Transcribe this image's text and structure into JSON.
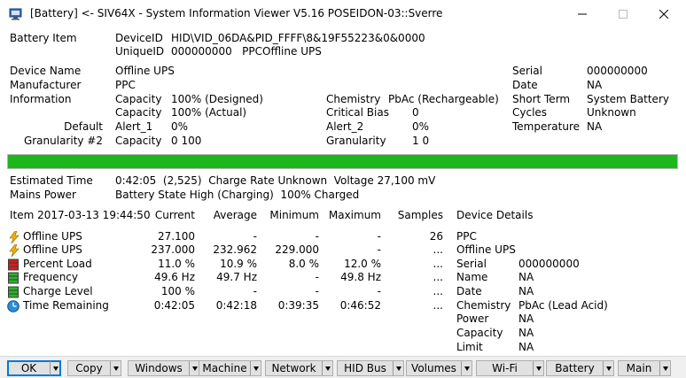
{
  "window": {
    "title": "[Battery] <- SIV64X - System Information Viewer V5.16 POSEIDON-03::Sverre"
  },
  "header": {
    "battery_item_label": "Battery Item",
    "device_id_key": "DeviceID",
    "device_id_value": "HID\\VID_06DA&PID_FFFF\\8&19F55223&0&0000",
    "unique_id_key": "UniqueID",
    "unique_id_value": "000000000   PPCOffline UPS"
  },
  "info": {
    "device_name_label": "Device Name",
    "device_name_value": "Offline UPS",
    "manufacturer_label": "Manufacturer",
    "manufacturer_value": "PPC",
    "information_label": "Information",
    "default_label": "Default",
    "granularity_label": "Granularity #2",
    "capacity1_key": "Capacity",
    "capacity1_value": "100% (Designed)",
    "capacity2_key": "Capacity",
    "capacity2_value": "100% (Actual)",
    "alert1_key": "Alert_1",
    "alert1_value": "0%",
    "capacity3_key": "Capacity",
    "capacity3_value": "0 100",
    "chemistry_key": "Chemistry",
    "chemistry_value": "PbAc (Rechargeable)",
    "critical_bias_key": "Critical Bias",
    "critical_bias_value": "0",
    "alert2_key": "Alert_2",
    "alert2_value": "0%",
    "granularity_key": "Granularity",
    "granularity_value": "1 0",
    "serial_key": "Serial",
    "serial_value": "000000000",
    "date_key": "Date",
    "date_value": "NA",
    "short_term_key": "Short Term",
    "short_term_value": "System Battery",
    "cycles_key": "Cycles",
    "cycles_value": "Unknown",
    "temperature_key": "Temperature",
    "temperature_value": "NA"
  },
  "charge": {
    "level_percent": 100,
    "color": "#1db61d"
  },
  "status": {
    "estimated_time_label": "Estimated Time",
    "estimated_time_value": "0:42:05  (2,525)  Charge Rate Unknown  Voltage 27,100 mV",
    "mains_power_label": "Mains Power",
    "mains_power_value": "Battery State High (Charging)  100% Charged"
  },
  "table": {
    "item_header": "Item 2017-03-13 19:44:50",
    "headers": [
      "Current",
      "Average",
      "Minimum",
      "Maximum",
      "Samples",
      "Device Details"
    ],
    "rows": [
      {
        "icon": "lightning-icon",
        "label": "Offline UPS",
        "current": "27.100",
        "average": "-",
        "minimum": "-",
        "maximum": "-",
        "samples": "26"
      },
      {
        "icon": "lightning-icon",
        "label": "Offline UPS",
        "current": "237.000",
        "average": "232.962",
        "minimum": "229.000",
        "maximum": "-",
        "samples": "..."
      },
      {
        "icon": "battery-red-icon",
        "label": "Percent Load",
        "current": "11.0 %",
        "average": "10.9 %",
        "minimum": "8.0 %",
        "maximum": "12.0 %",
        "samples": "..."
      },
      {
        "icon": "battery-green-icon",
        "label": "Frequency",
        "current": "49.6 Hz",
        "average": "49.7 Hz",
        "minimum": "-",
        "maximum": "49.8 Hz",
        "samples": "..."
      },
      {
        "icon": "battery-green-icon",
        "label": "Charge Level",
        "current": "100 %",
        "average": "-",
        "minimum": "-",
        "maximum": "-",
        "samples": "..."
      },
      {
        "icon": "clock-icon",
        "label": "Time Remaining",
        "current": "0:42:05",
        "average": "0:42:18",
        "minimum": "0:39:35",
        "maximum": "0:46:52",
        "samples": "..."
      }
    ],
    "details": [
      {
        "key": "PPC",
        "value": ""
      },
      {
        "key": "Offline UPS",
        "value": ""
      },
      {
        "key": "Serial",
        "value": "000000000"
      },
      {
        "key": "Name",
        "value": "NA"
      },
      {
        "key": "Date",
        "value": "NA"
      },
      {
        "key": "Chemistry",
        "value": "PbAc (Lead Acid)"
      },
      {
        "key": "Power",
        "value": "NA"
      },
      {
        "key": "Capacity",
        "value": "NA"
      },
      {
        "key": "Limit",
        "value": "NA"
      }
    ]
  },
  "buttons": [
    {
      "label": "OK"
    },
    {
      "label": "Copy"
    },
    {
      "label": "Windows"
    },
    {
      "label": "Machine"
    },
    {
      "label": "Network"
    },
    {
      "label": "HID Bus"
    },
    {
      "label": "Volumes"
    },
    {
      "label": "Wi-Fi"
    },
    {
      "label": "Battery"
    },
    {
      "label": "Main"
    }
  ]
}
